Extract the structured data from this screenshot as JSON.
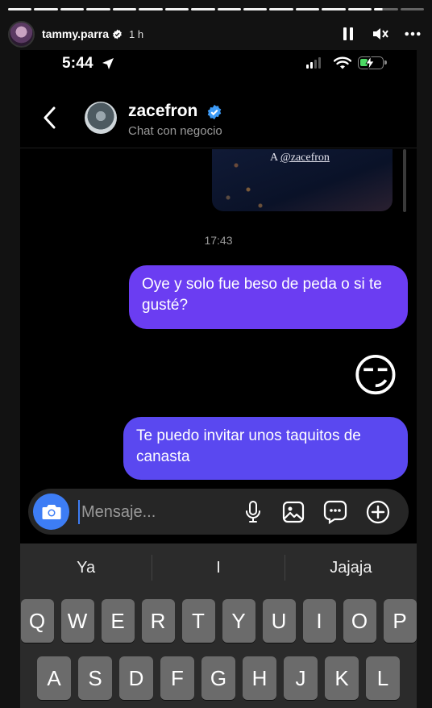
{
  "story": {
    "username": "tammy.parra",
    "time": "1 h",
    "segments": 16,
    "partial_segment": 15
  },
  "status_bar": {
    "time": "5:44"
  },
  "chat": {
    "name": "zacefron",
    "subtitle": "Chat con negocio",
    "shared_caption_prefix": "A",
    "shared_caption_handle": "@zacefron",
    "timestamp": "17:43",
    "messages": [
      {
        "from": "me",
        "text": "Oye y solo fue beso de peda o si te gusté?"
      },
      {
        "from": "me",
        "type": "emoji",
        "text": "😏"
      },
      {
        "from": "me",
        "text": "Te puedo invitar unos taquitos de canasta"
      }
    ]
  },
  "composer": {
    "placeholder": "Mensaje..."
  },
  "keyboard": {
    "suggestions": [
      "Ya",
      "I",
      "Jajaja"
    ],
    "row1": [
      "Q",
      "W",
      "E",
      "R",
      "T",
      "Y",
      "U",
      "I",
      "O",
      "P"
    ],
    "row2": [
      "A",
      "S",
      "D",
      "F",
      "G",
      "H",
      "J",
      "K",
      "L"
    ]
  },
  "colors": {
    "bubble_primary": "#6b3df2",
    "bubble_secondary": "#5a48f0",
    "verified_blue": "#3d9bf7",
    "camera_blue": "#3d7df5"
  }
}
